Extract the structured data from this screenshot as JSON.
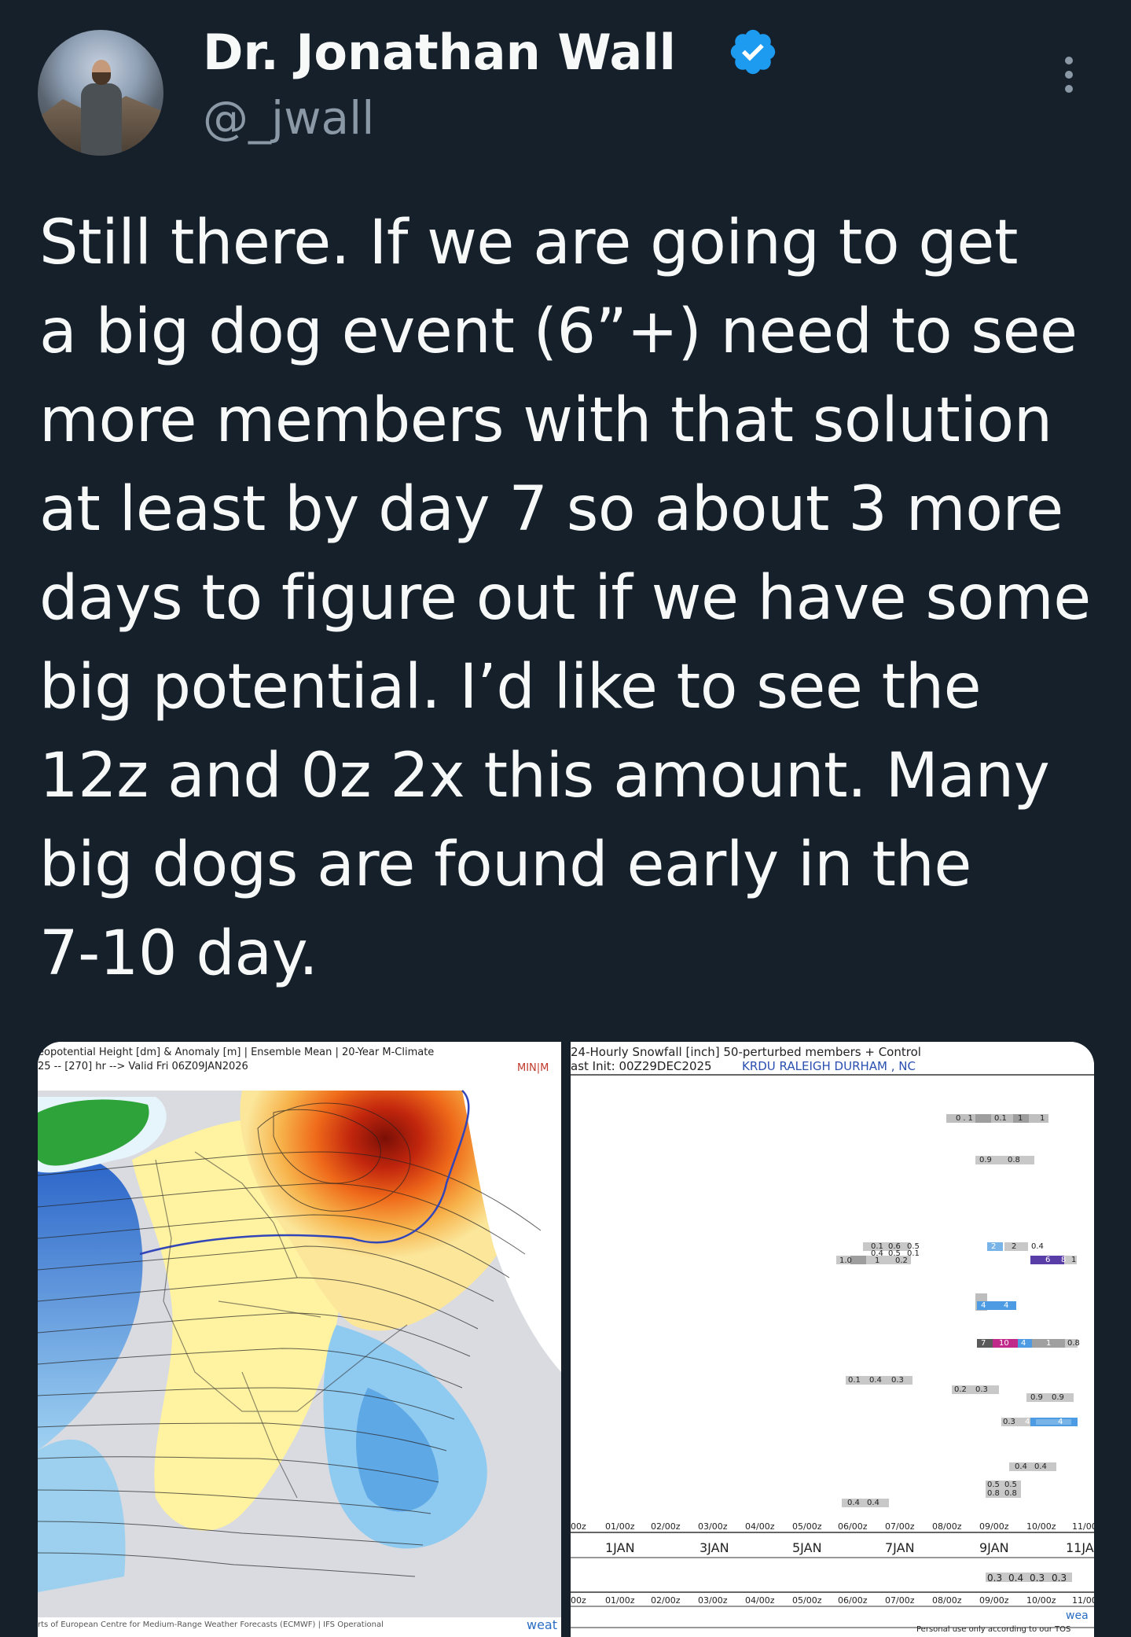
{
  "author": {
    "name": "Dr. Jonathan Wall",
    "handle": "@_jwall"
  },
  "tweet": {
    "text": "Still there. If we are going to get\na big dog event (6”+) need to see\nmore members with that solution\nat least by day 7 so about 3 more\ndays to figure out if we have some\nbig potential. I’d like to see the\n12z and 0z 2x this amount. Many\nbig dogs are found early in the\n7-10 day."
  },
  "media": {
    "map": {
      "header_line1": "eopotential Height [dm] & Anomaly [m] | Ensemble Mean | 20-Year M-Climate",
      "header_line2": "25 -- [270] hr --> Valid Fri 06Z09JAN2026",
      "tag": "MIN|M",
      "footer": "rts of European Centre for Medium-Range Weather Forecasts (ECMWF) | IFS Operational",
      "brand": "weat"
    },
    "snowfall": {
      "header_line1": "24-Hourly Snowfall [inch]  50-perturbed members + Control",
      "header_line2": "ast Init: 00Z29DEC2025",
      "location": "KRDU RALEIGH DURHAM , NC",
      "times": [
        "00z",
        "01/00z",
        "02/00z",
        "03/00z",
        "04/00z",
        "05/00z",
        "06/00z",
        "07/00z",
        "08/00z",
        "09/00z",
        "10/00z",
        "11/00"
      ],
      "dates": [
        "1JAN",
        "3JAN",
        "5JAN",
        "7JAN",
        "9JAN",
        "11JA"
      ],
      "mean_values": [
        "0.3",
        "0.4",
        "0.3",
        "0.3"
      ],
      "disclaimer": "Personal use only according to our TOS",
      "brand": "wea",
      "member_values": [
        [
          "0.1",
          "0.1",
          "1",
          "1"
        ],
        [
          "0.9",
          "0.8"
        ],
        [
          "0.1",
          "0.6",
          "0.5"
        ],
        [
          "0.4",
          "0.5",
          "0.1"
        ],
        [
          "1.0",
          "1",
          "0.2"
        ],
        [
          "2",
          "2",
          "0.4"
        ],
        [
          "6",
          "8",
          "1"
        ],
        [
          "4",
          "4"
        ],
        [
          "7",
          "10",
          "4",
          "1",
          "0.8"
        ],
        [
          "0.1",
          "0.4",
          "0.3"
        ],
        [
          "0.2",
          "0.3"
        ],
        [
          "0.9",
          "0.9"
        ],
        [
          "0.3",
          "4",
          "4"
        ],
        [
          "0.4",
          "0.4"
        ],
        [
          "0.5",
          "0.5"
        ],
        [
          "0.8",
          "0.8"
        ],
        [
          "0.4",
          "0.4"
        ]
      ]
    }
  }
}
